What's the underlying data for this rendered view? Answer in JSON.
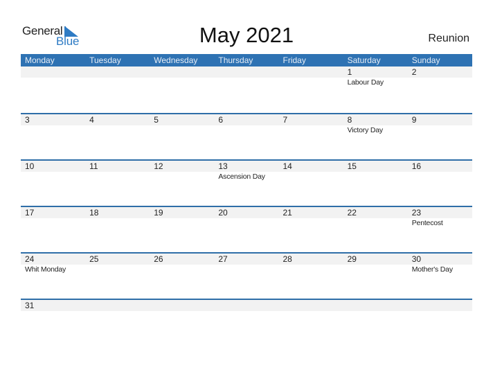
{
  "brand": {
    "word1": "General",
    "word2": "Blue",
    "color": "#2e7bc4"
  },
  "header": {
    "title": "May 2021",
    "region": "Reunion"
  },
  "colors": {
    "header_bg": "#2e72b3",
    "row_shade": "#f2f2f2",
    "divider": "#2e6ea8"
  },
  "weekdays": [
    "Monday",
    "Tuesday",
    "Wednesday",
    "Thursday",
    "Friday",
    "Saturday",
    "Sunday"
  ],
  "weeks": [
    [
      {
        "day": "",
        "event": ""
      },
      {
        "day": "",
        "event": ""
      },
      {
        "day": "",
        "event": ""
      },
      {
        "day": "",
        "event": ""
      },
      {
        "day": "",
        "event": ""
      },
      {
        "day": "1",
        "event": "Labour Day"
      },
      {
        "day": "2",
        "event": ""
      }
    ],
    [
      {
        "day": "3",
        "event": ""
      },
      {
        "day": "4",
        "event": ""
      },
      {
        "day": "5",
        "event": ""
      },
      {
        "day": "6",
        "event": ""
      },
      {
        "day": "7",
        "event": ""
      },
      {
        "day": "8",
        "event": "Victory Day"
      },
      {
        "day": "9",
        "event": ""
      }
    ],
    [
      {
        "day": "10",
        "event": ""
      },
      {
        "day": "11",
        "event": ""
      },
      {
        "day": "12",
        "event": ""
      },
      {
        "day": "13",
        "event": "Ascension Day"
      },
      {
        "day": "14",
        "event": ""
      },
      {
        "day": "15",
        "event": ""
      },
      {
        "day": "16",
        "event": ""
      }
    ],
    [
      {
        "day": "17",
        "event": ""
      },
      {
        "day": "18",
        "event": ""
      },
      {
        "day": "19",
        "event": ""
      },
      {
        "day": "20",
        "event": ""
      },
      {
        "day": "21",
        "event": ""
      },
      {
        "day": "22",
        "event": ""
      },
      {
        "day": "23",
        "event": "Pentecost"
      }
    ],
    [
      {
        "day": "24",
        "event": "Whit Monday"
      },
      {
        "day": "25",
        "event": ""
      },
      {
        "day": "26",
        "event": ""
      },
      {
        "day": "27",
        "event": ""
      },
      {
        "day": "28",
        "event": ""
      },
      {
        "day": "29",
        "event": ""
      },
      {
        "day": "30",
        "event": "Mother's Day"
      }
    ],
    [
      {
        "day": "31",
        "event": ""
      },
      {
        "day": "",
        "event": ""
      },
      {
        "day": "",
        "event": ""
      },
      {
        "day": "",
        "event": ""
      },
      {
        "day": "",
        "event": ""
      },
      {
        "day": "",
        "event": ""
      },
      {
        "day": "",
        "event": ""
      }
    ]
  ]
}
